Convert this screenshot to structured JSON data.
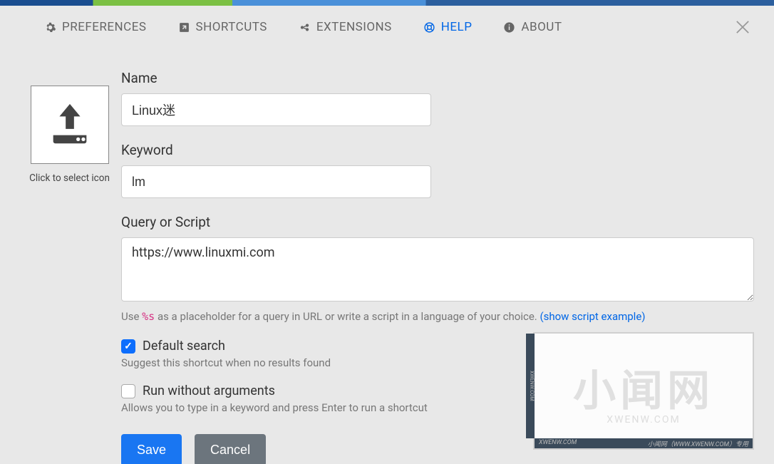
{
  "tabs": {
    "preferences": "PREFERENCES",
    "shortcuts": "SHORTCUTS",
    "extensions": "EXTENSIONS",
    "help": "HELP",
    "about": "ABOUT"
  },
  "icon_panel": {
    "caption": "Click to select icon"
  },
  "form": {
    "name_label": "Name",
    "name_value": "Linux迷",
    "keyword_label": "Keyword",
    "keyword_value": "lm",
    "query_label": "Query or Script",
    "query_value": "https://www.linuxmi.com",
    "hint_prefix": "Use ",
    "hint_code": "%s",
    "hint_suffix": " as a placeholder for a query in URL or write a script in a language of your choice. ",
    "hint_link": "(show script example)",
    "default_search_label": "Default search",
    "default_search_hint": "Suggest this shortcut when no results found",
    "default_search_checked": true,
    "run_without_args_label": "Run without arguments",
    "run_without_args_hint": "Allows you to type in a keyword and press Enter to run a shortcut",
    "run_without_args_checked": false
  },
  "buttons": {
    "save": "Save",
    "cancel": "Cancel"
  },
  "watermark": {
    "main": "小闻网",
    "sub": "XWENW.COM",
    "footer_left": "XWENW.COM",
    "footer_right": "小闻网（WWW.XWENW.COM）专用",
    "side": "XWENW.COM"
  }
}
